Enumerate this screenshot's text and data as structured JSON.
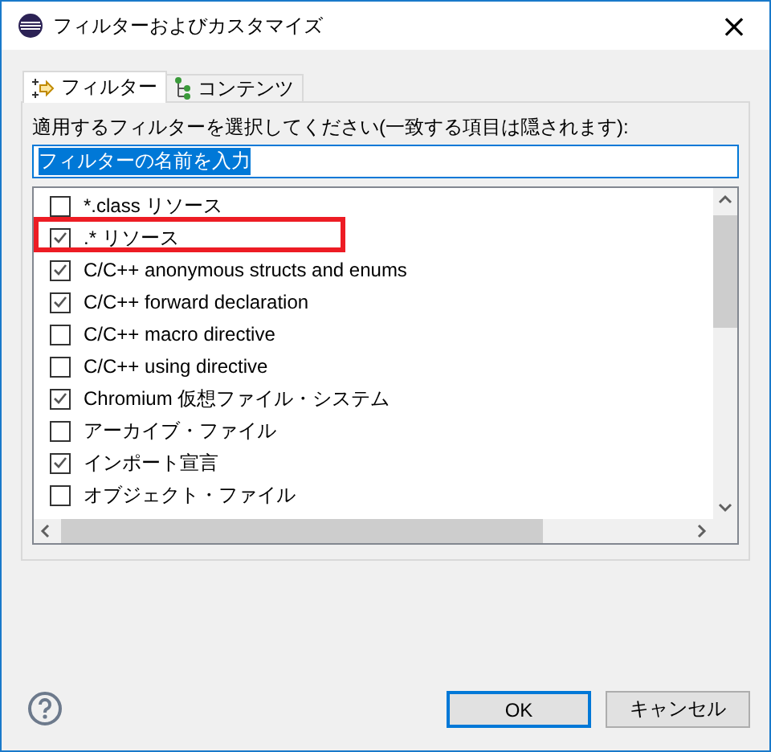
{
  "window": {
    "title": "フィルターおよびカスタマイズ",
    "close": "×"
  },
  "tabs": [
    {
      "label": "フィルター",
      "selected": true,
      "kind": "filter"
    },
    {
      "label": "コンテンツ",
      "selected": false,
      "kind": "tree"
    }
  ],
  "instruction": "適用するフィルターを選択してください(一致する項目は隠されます):",
  "search": {
    "value": "フィルターの名前を入力"
  },
  "filters": [
    {
      "label": "*.class リソース",
      "checked": false,
      "highlighted": false
    },
    {
      "label": ".* リソース",
      "checked": true,
      "highlighted": true
    },
    {
      "label": "C/C++ anonymous structs and enums",
      "checked": true,
      "highlighted": false
    },
    {
      "label": "C/C++ forward declaration",
      "checked": true,
      "highlighted": false
    },
    {
      "label": "C/C++ macro directive",
      "checked": false,
      "highlighted": false
    },
    {
      "label": "C/C++ using directive",
      "checked": false,
      "highlighted": false
    },
    {
      "label": "Chromium 仮想ファイル・システム",
      "checked": true,
      "highlighted": false
    },
    {
      "label": "アーカイブ・ファイル",
      "checked": false,
      "highlighted": false
    },
    {
      "label": "インポート宣言",
      "checked": true,
      "highlighted": false
    },
    {
      "label": "オブジェクト・ファイル",
      "checked": false,
      "highlighted": false
    }
  ],
  "buttons": [
    {
      "label": "OK",
      "default": true
    },
    {
      "label": "キャンセル",
      "default": false
    }
  ]
}
